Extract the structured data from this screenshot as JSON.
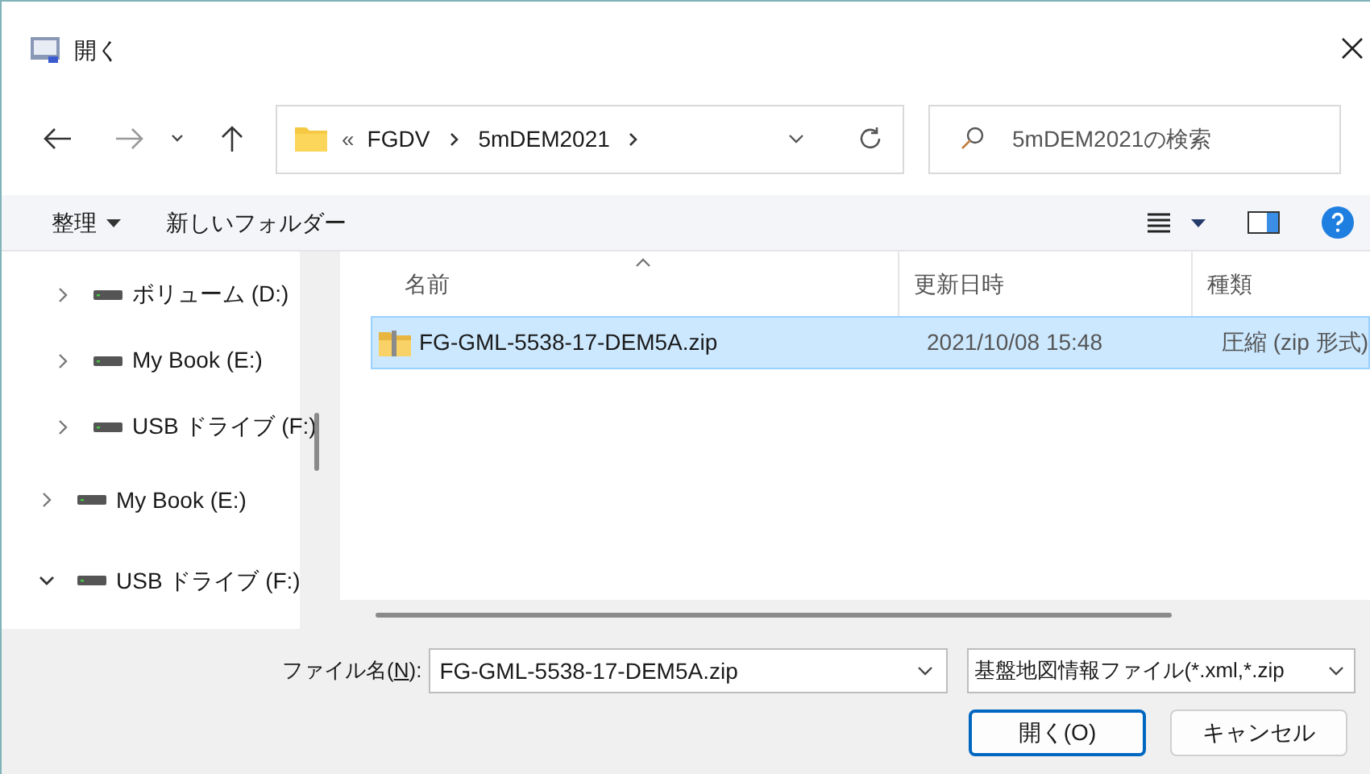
{
  "window": {
    "title": "開く"
  },
  "address": {
    "overflow": "«",
    "crumbs": [
      "FGDV",
      "5mDEM2021"
    ]
  },
  "search": {
    "placeholder": "5mDEM2021の検索"
  },
  "toolbar": {
    "organize": "整理",
    "new_folder": "新しいフォルダー"
  },
  "nav": {
    "nested_items": [
      {
        "label": "ボリューム (D:)",
        "expanded": false
      },
      {
        "label": "My Book (E:)",
        "expanded": false
      },
      {
        "label": "USB ドライブ (F:)",
        "expanded": false
      }
    ],
    "items": [
      {
        "label": "My Book (E:)",
        "expanded": false
      },
      {
        "label": "USB ドライブ (F:)",
        "expanded": true
      }
    ]
  },
  "table": {
    "columns": [
      {
        "label": "名前",
        "sorted": true
      },
      {
        "label": "更新日時",
        "sorted": false
      },
      {
        "label": "種類",
        "sorted": false
      }
    ],
    "rows": [
      {
        "name": "FG-GML-5538-17-DEM5A.zip",
        "modified": "2021/10/08 15:48",
        "type": "圧縮 (zip 形式)",
        "selected": true
      }
    ]
  },
  "footer": {
    "filename_label": {
      "before": "ファイル名(",
      "key": "N",
      "after": "):"
    },
    "filename": "FG-GML-5538-17-DEM5A.zip",
    "filter": "基盤地図情報ファイル(*.xml,*.zip",
    "buttons": [
      {
        "label": "開く(O)",
        "default": true
      },
      {
        "label": "キャンセル",
        "default": false
      }
    ]
  }
}
